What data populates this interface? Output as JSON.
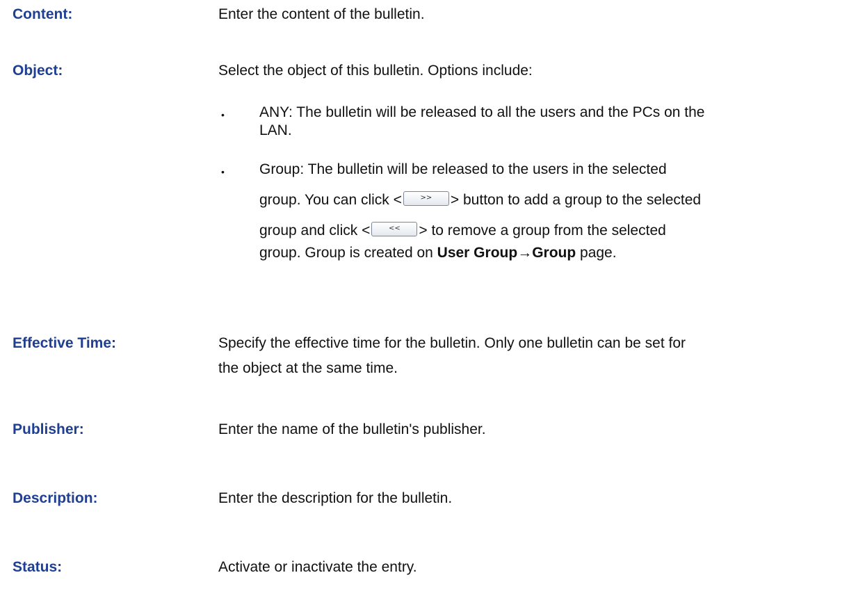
{
  "content": {
    "term": "Content:",
    "desc": "Enter the content of the bulletin."
  },
  "object": {
    "term": "Object:",
    "desc": "Select the object of this bulletin. Options include:",
    "bullet_mark": "•",
    "any_line1": "ANY: The bulletin will be released to all the users and the PCs on the",
    "any_line2": "LAN.",
    "group": {
      "line1": "Group: The bulletin will be released to the users in the selected",
      "line2_a": "group. You can click <",
      "add_button_label": ">>",
      "line2_b": "> button to add a group to the selected",
      "line3_a": "group and click <",
      "remove_button_label": "<<",
      "line3_b": "> to remove a group from the selected",
      "line4_a": "group. Group is created on ",
      "line4_bold1": "User Group",
      "line4_arrow": "→",
      "line4_bold2": "Group",
      "line4_b": " page."
    }
  },
  "effective_time": {
    "term": "Effective Time:",
    "line1": "Specify the effective time for the bulletin. Only one bulletin can be set for",
    "line2": "the object at the same time."
  },
  "publisher": {
    "term": "Publisher:",
    "desc": "Enter the name of the bulletin's publisher."
  },
  "description": {
    "term": "Description:",
    "desc": "Enter the description for the bulletin."
  },
  "status": {
    "term": "Status:",
    "desc": "Activate or inactivate the entry."
  }
}
